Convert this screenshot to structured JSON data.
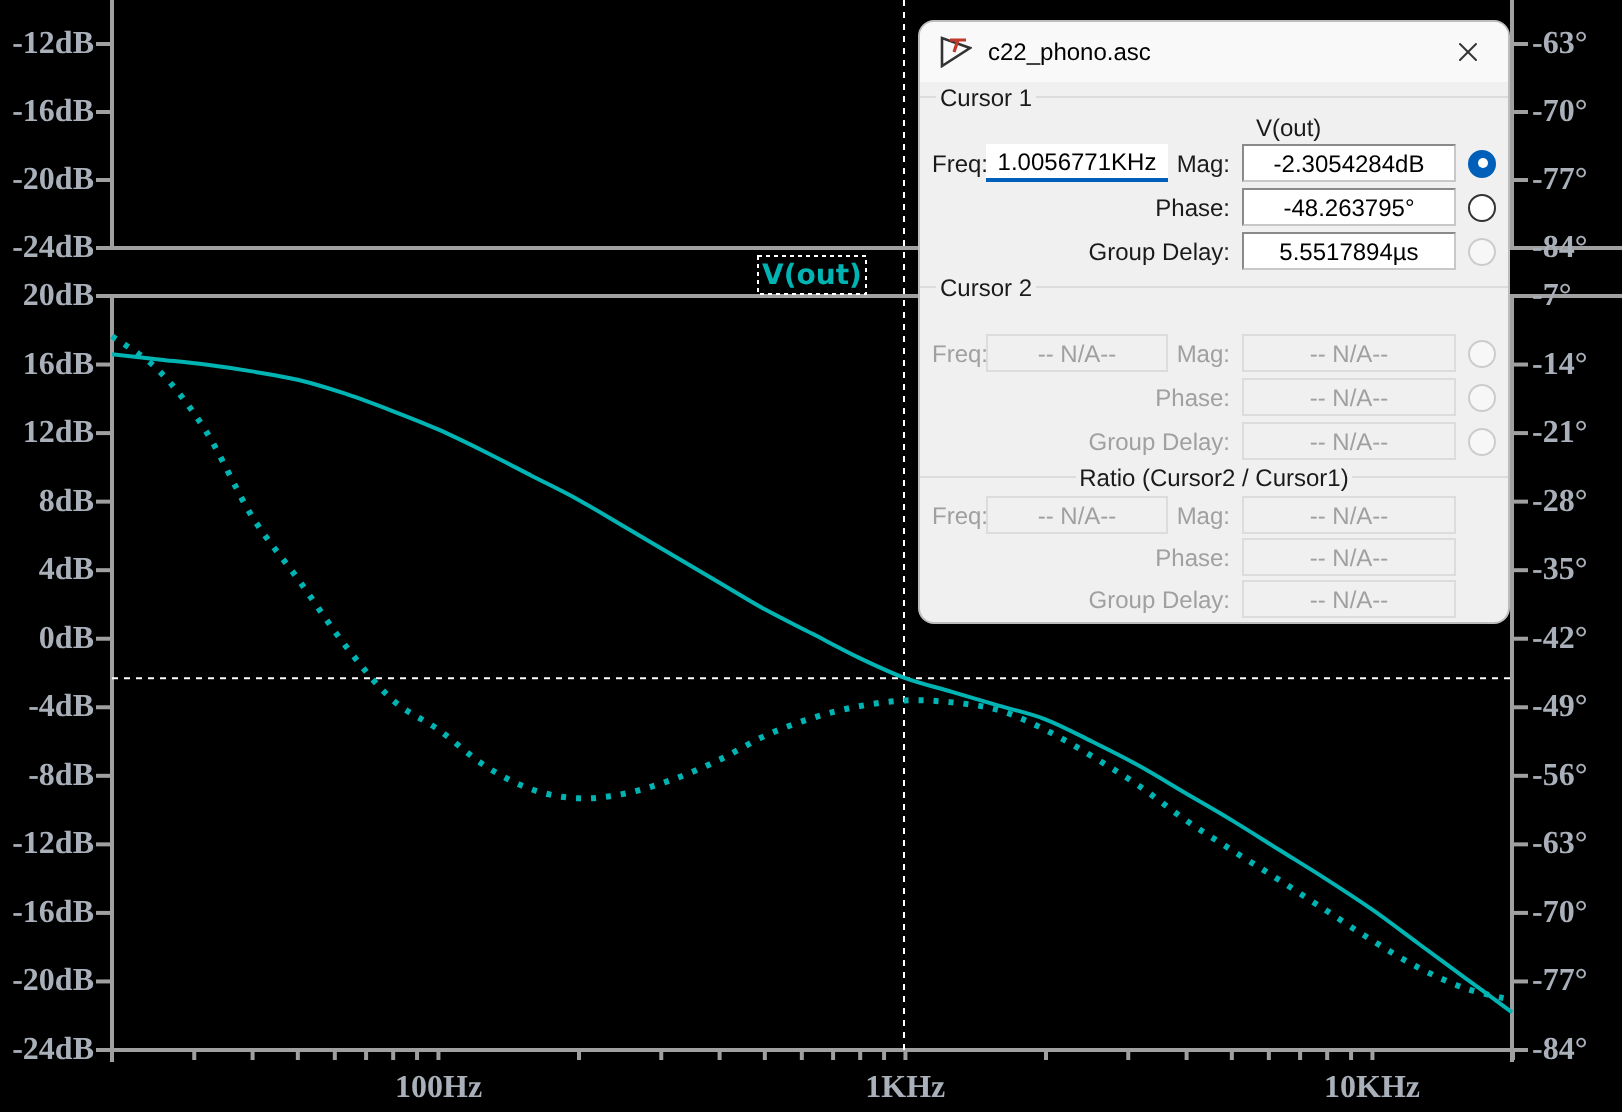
{
  "plot": {
    "trace_label": "V(out)",
    "top_pane": {
      "left_axis_labels": [
        "-12dB",
        "-16dB",
        "-20dB",
        "-24dB"
      ],
      "right_axis_labels": [
        "-63°",
        "-70°",
        "-77°",
        "-84°"
      ]
    },
    "chart_data": {
      "type": "line",
      "categories": [
        null,
        null,
        null,
        null,
        null,
        null,
        null,
        "100Hz",
        null,
        null,
        null,
        null,
        null,
        null,
        null,
        null,
        null,
        "1KHz",
        null,
        null,
        null,
        null,
        null,
        null,
        null,
        null,
        null,
        "10KHz",
        null,
        null,
        null
      ],
      "ylim": [
        -24,
        20
      ],
      "yticks": [
        {
          "value": 20,
          "label": "20dB"
        },
        {
          "value": 16,
          "label": "16dB"
        },
        {
          "value": 12,
          "label": "12dB"
        },
        {
          "value": 8,
          "label": "8dB"
        },
        {
          "value": 4,
          "label": "4dB"
        },
        {
          "value": 0,
          "label": "0dB"
        },
        {
          "value": -4,
          "label": "-4dB"
        },
        {
          "value": -8,
          "label": "-8dB"
        },
        {
          "value": -12,
          "label": "-12dB"
        },
        {
          "value": -16,
          "label": "-16dB"
        },
        {
          "value": -20,
          "label": "-20dB"
        },
        {
          "value": -24,
          "label": "-24dB"
        }
      ],
      "ref_lines": [
        {
          "axis": "y",
          "value": -2.3054284
        }
      ],
      "y2lim": [
        -84,
        -7
      ],
      "y2ticks": [
        {
          "value": -7,
          "label": "-7°"
        },
        {
          "value": -14,
          "label": "-14°"
        },
        {
          "value": -21,
          "label": "-21°"
        },
        {
          "value": -28,
          "label": "-28°"
        },
        {
          "value": -35,
          "label": "-35°"
        },
        {
          "value": -42,
          "label": "-42°"
        },
        {
          "value": -49,
          "label": "-49°"
        },
        {
          "value": -56,
          "label": "-56°"
        },
        {
          "value": -63,
          "label": "-63°"
        },
        {
          "value": -70,
          "label": "-70°"
        },
        {
          "value": -77,
          "label": "-77°"
        },
        {
          "value": -84,
          "label": "-84°"
        }
      ],
      "series": [
        {
          "color": "#00b4b4",
          "values": [
            16.6,
            16.3,
            16.0,
            15.6,
            15.1,
            14.3,
            13.3,
            12.2,
            10.9,
            9.5,
            8.1,
            6.5,
            4.9,
            3.3,
            1.7,
            0.3,
            -1.1,
            -2.3,
            -3.1,
            -3.9,
            -4.7,
            -6.0,
            -7.4,
            -9.0,
            -10.6,
            -12.3,
            -14.0,
            -15.8,
            -17.8,
            -19.8,
            -21.8
          ]
        },
        {
          "color": "#00b4b4",
          "axis": "y2",
          "line_style": "dotted",
          "values": [
            -11.1,
            -14.6,
            -20.7,
            -29.5,
            -36.0,
            -42.7,
            -48.2,
            -51.3,
            -55.0,
            -57.4,
            -58.3,
            -57.8,
            -56.4,
            -54.4,
            -51.9,
            -50.1,
            -48.9,
            -48.3,
            -48.5,
            -49.3,
            -51.3,
            -54.0,
            -57.0,
            -60.5,
            -63.6,
            -66.6,
            -69.7,
            -72.8,
            -75.6,
            -77.7,
            -78.9
          ]
        }
      ]
    }
  },
  "dialog": {
    "title": "c22_phono.asc",
    "sections": [
      {
        "kind": "cursor",
        "title": "Cursor 1",
        "trace": "V(out)",
        "disabled": false,
        "freq": {
          "label": "Freq:",
          "value": "1.0056771KHz",
          "focused": true
        },
        "values": [
          {
            "label": "Mag:",
            "value": "-2.3054284dB",
            "selected": true,
            "radio_disabled": false
          },
          {
            "label": "Phase:",
            "value": "-48.263795°",
            "selected": false,
            "radio_disabled": false
          },
          {
            "label": "Group Delay:",
            "value": "5.5517894µs",
            "selected": false,
            "radio_disabled": true
          }
        ]
      },
      {
        "kind": "cursor",
        "title": "Cursor 2",
        "disabled": true,
        "freq": {
          "label": "Freq:",
          "value": "-- N/A--"
        },
        "values": [
          {
            "label": "Mag:",
            "value": "-- N/A--",
            "selected": false,
            "radio_disabled": true
          },
          {
            "label": "Phase:",
            "value": "-- N/A--",
            "selected": false,
            "radio_disabled": true
          },
          {
            "label": "Group Delay:",
            "value": "-- N/A--",
            "selected": false,
            "radio_disabled": true
          }
        ]
      },
      {
        "kind": "ratio",
        "title": "Ratio (Cursor2 / Cursor1)",
        "disabled": true,
        "freq": {
          "label": "Freq:",
          "value": "-- N/A--"
        },
        "values": [
          {
            "label": "Mag:",
            "value": "-- N/A--"
          },
          {
            "label": "Phase:",
            "value": "-- N/A--"
          },
          {
            "label": "Group Delay:",
            "value": "-- N/A--"
          }
        ]
      }
    ]
  }
}
